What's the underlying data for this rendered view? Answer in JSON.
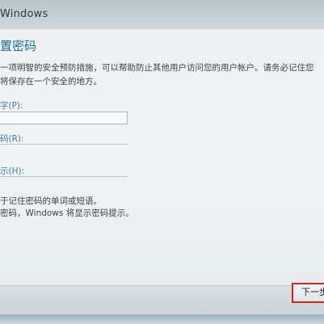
{
  "window": {
    "title": "Windows"
  },
  "page": {
    "heading": "置密码",
    "description_line1": "一项明智的安全预防措施，可以帮助防止其他用户访问您的用户帐户。请务必记住您",
    "description_line2": "将保存在一个安全的地方。"
  },
  "form": {
    "password_label": "字(P):",
    "password_value": "",
    "confirm_label": "码(R):",
    "confirm_value": "",
    "hint_label": "示(H):",
    "hint_value": ""
  },
  "hint_text": {
    "line1": "于记住密码的单词或短语。",
    "line2": "密码，Windows 将显示密码提示。"
  },
  "buttons": {
    "next_label": "下一步"
  },
  "colors": {
    "heading": "#1f6f9c",
    "field_label": "#3f7fa0",
    "highlight_border": "#e02020"
  }
}
